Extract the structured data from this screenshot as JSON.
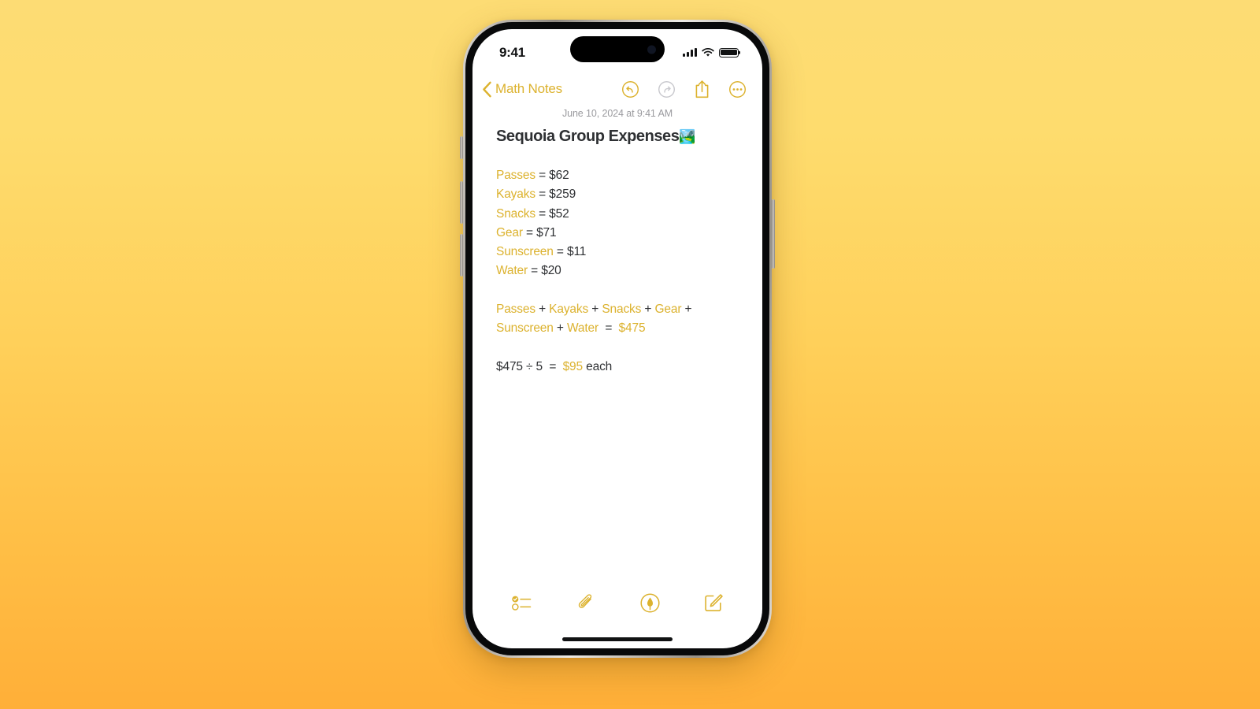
{
  "background": {
    "gradient_from": "#FDDC74",
    "gradient_to": "#FFAF38"
  },
  "device": {
    "name": "iPhone 15 Pro",
    "frame_color": "#b7b2ab"
  },
  "status_bar": {
    "time": "9:41",
    "signal_icon": "cellular-signal-icon",
    "wifi_icon": "wifi-icon",
    "battery_icon": "battery-full-icon",
    "battery_level": 100
  },
  "nav_bar": {
    "back_label": "Math Notes",
    "back_icon": "chevron-left-icon",
    "accent_color": "#DCB22E",
    "disabled_color": "#C9C9CE",
    "actions": [
      {
        "name": "undo-button",
        "icon": "undo-arrow-circle-icon",
        "enabled": true
      },
      {
        "name": "redo-button",
        "icon": "redo-arrow-circle-icon",
        "enabled": false
      },
      {
        "name": "share-button",
        "icon": "share-square-arrow-up-icon",
        "enabled": true
      },
      {
        "name": "more-options-button",
        "icon": "ellipsis-circle-icon",
        "enabled": true
      }
    ]
  },
  "note": {
    "date": "June 10, 2024 at 9:41 AM",
    "title": "Sequoia Group Expenses",
    "title_emoji": "🏞️",
    "variable_color": "#DCB22E",
    "text_color": "#2e3033",
    "assignments": [
      {
        "name": "Passes",
        "op": " = ",
        "value": "$62"
      },
      {
        "name": "Kayaks",
        "op": " = ",
        "value": "$259"
      },
      {
        "name": "Snacks",
        "op": " = ",
        "value": "$52"
      },
      {
        "name": "Gear",
        "op": " = ",
        "value": "$71"
      },
      {
        "name": "Sunscreen",
        "op": " = ",
        "value": "$11"
      },
      {
        "name": "Water",
        "op": " = ",
        "value": "$20"
      }
    ],
    "sum_line": {
      "line1": [
        {
          "t": "Passes",
          "k": "var"
        },
        {
          "t": " + ",
          "k": "op"
        },
        {
          "t": "Kayaks",
          "k": "var"
        },
        {
          "t": " + ",
          "k": "op"
        },
        {
          "t": "Snacks",
          "k": "var"
        },
        {
          "t": " + ",
          "k": "op"
        },
        {
          "t": "Gear",
          "k": "var"
        },
        {
          "t": " +",
          "k": "op"
        }
      ],
      "line2": [
        {
          "t": "Sunscreen",
          "k": "var"
        },
        {
          "t": " + ",
          "k": "op"
        },
        {
          "t": "Water",
          "k": "var"
        },
        {
          "t": "  =  ",
          "k": "op"
        },
        {
          "t": "$475",
          "k": "result"
        }
      ]
    },
    "division_line": [
      {
        "t": "$475 ÷ 5  =  ",
        "k": "op"
      },
      {
        "t": "$95",
        "k": "result"
      },
      {
        "t": " each",
        "k": "op"
      }
    ]
  },
  "bottom_toolbar": {
    "accent_color": "#DCB22E",
    "items": [
      {
        "name": "checklist-button",
        "icon": "checklist-icon"
      },
      {
        "name": "attachment-button",
        "icon": "paperclip-icon"
      },
      {
        "name": "markup-button",
        "icon": "markup-pen-circle-icon"
      },
      {
        "name": "compose-button",
        "icon": "compose-square-pencil-icon"
      }
    ]
  }
}
